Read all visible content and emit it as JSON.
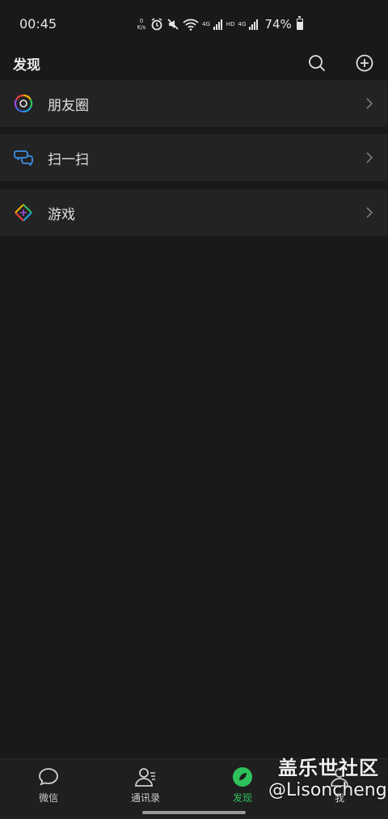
{
  "status_bar": {
    "time": "00:45",
    "net_speed_value": "0",
    "net_speed_unit": "K/s",
    "lte1": "4G",
    "hd": "HD",
    "lte2": "4G",
    "battery": "74%"
  },
  "header": {
    "title": "发现"
  },
  "menu": {
    "items": [
      {
        "label": "朋友圈",
        "icon": "moments-icon"
      },
      {
        "label": "扫一扫",
        "icon": "scan-icon"
      },
      {
        "label": "游戏",
        "icon": "games-icon"
      }
    ]
  },
  "tabs": [
    {
      "label": "微信",
      "icon": "chat-icon"
    },
    {
      "label": "通讯录",
      "icon": "contacts-icon"
    },
    {
      "label": "发现",
      "icon": "discover-icon",
      "active": true
    },
    {
      "label": "我",
      "icon": "me-icon"
    }
  ],
  "watermark": {
    "title": "盖乐世社区",
    "user": "@Lisoncheng"
  },
  "colors": {
    "accent": "#2fc25b",
    "background": "#191919",
    "cell": "#232323"
  }
}
